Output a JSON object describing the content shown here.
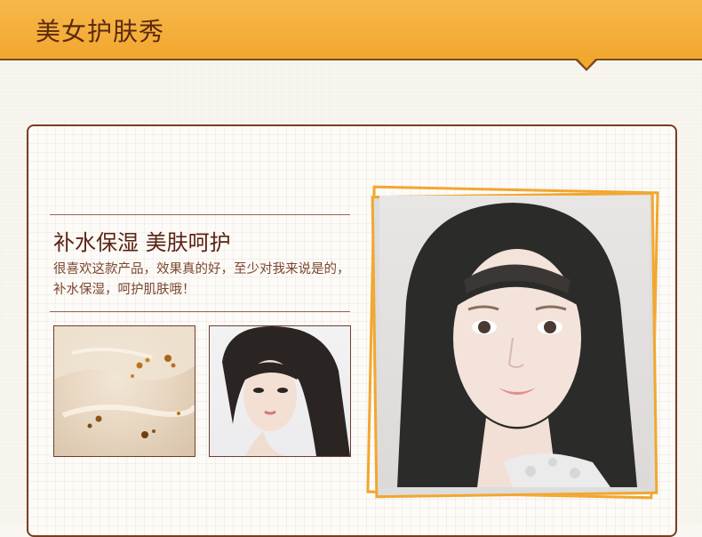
{
  "header": {
    "title": "美女护肤秀"
  },
  "section": {
    "heading": "补水保湿 美肤呵护",
    "description": "很喜欢这款产品，效果真的好，至少对我来说是的，补水保湿，呵护肌肤哦！"
  },
  "colors": {
    "accent": "#f2a72f",
    "brown": "#7a3d20",
    "text": "#5a2414"
  }
}
